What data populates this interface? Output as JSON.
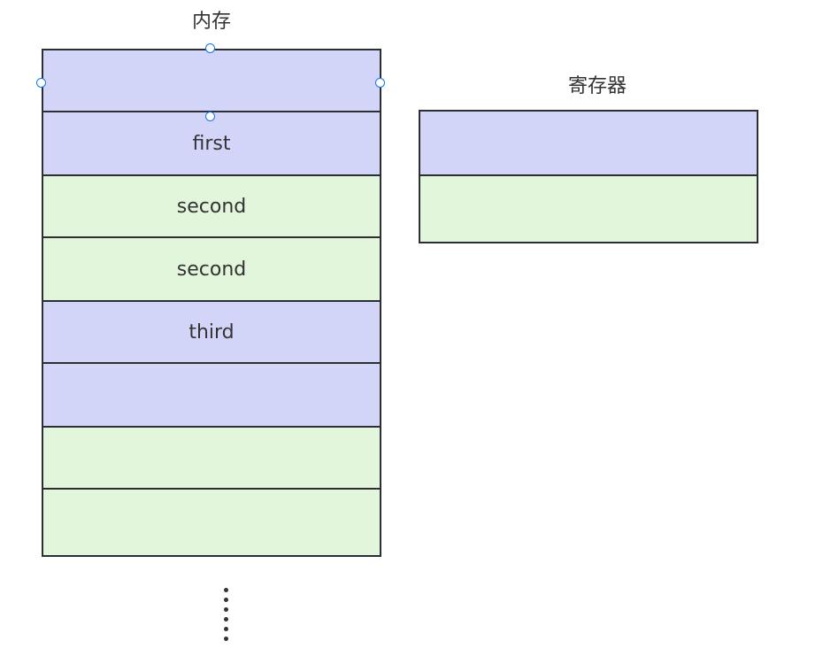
{
  "memory": {
    "title": "内存",
    "cells": [
      {
        "label": "",
        "color": "#d2d5f7"
      },
      {
        "label": "first",
        "color": "#d2d5f7"
      },
      {
        "label": "second",
        "color": "#e2f6db"
      },
      {
        "label": "second",
        "color": "#e2f6db"
      },
      {
        "label": "third",
        "color": "#d2d5f7"
      },
      {
        "label": "",
        "color": "#d2d5f7"
      },
      {
        "label": "",
        "color": "#e2f6db"
      },
      {
        "label": "",
        "color": "#e2f6db"
      }
    ],
    "continuation": "vertical-ellipsis"
  },
  "register": {
    "title": "寄存器",
    "cells": [
      {
        "label": "",
        "color": "#d2d5f7"
      },
      {
        "label": "",
        "color": "#e2f6db"
      }
    ]
  },
  "colors": {
    "handle": "#1677e8",
    "border": "#2b2f33"
  }
}
